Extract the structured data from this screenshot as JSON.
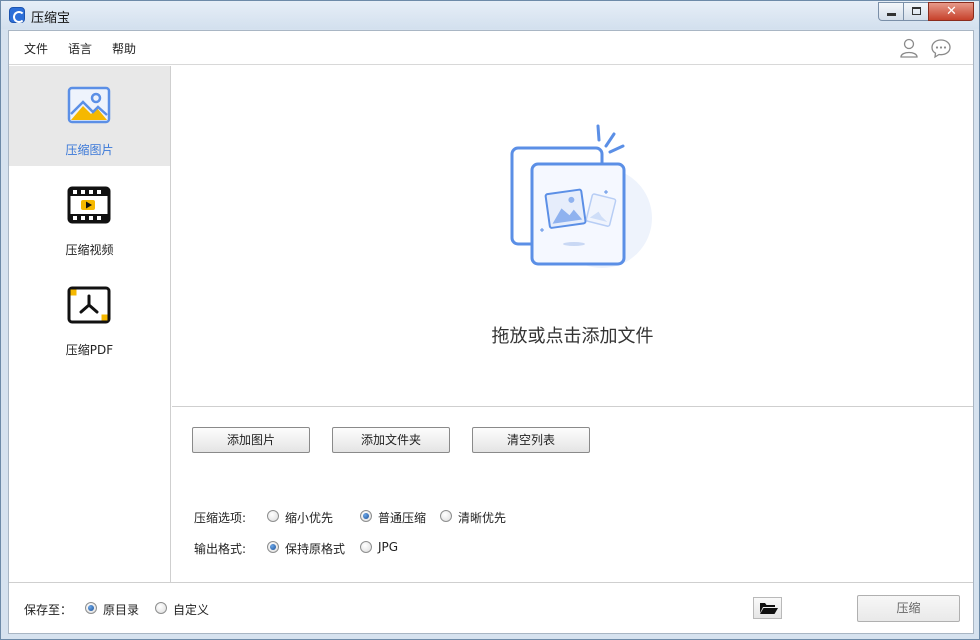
{
  "window": {
    "title": "压缩宝"
  },
  "menu": {
    "items": [
      "文件",
      "语言",
      "帮助"
    ],
    "user_icon": "user-icon",
    "chat_icon": "chat-bubble-icon"
  },
  "sidebar": {
    "items": [
      {
        "label": "压缩图片",
        "icon": "image-icon",
        "active": true
      },
      {
        "label": "压缩视频",
        "icon": "video-icon",
        "active": false
      },
      {
        "label": "压缩PDF",
        "icon": "pdf-icon",
        "active": false
      }
    ]
  },
  "dropzone": {
    "text": "拖放或点击添加文件",
    "icon": "add-images-illustration-icon"
  },
  "buttons": {
    "add_images": "添加图片",
    "add_folder": "添加文件夹",
    "clear_list": "清空列表"
  },
  "options": {
    "compress_label": "压缩选项:",
    "compress_choices": [
      {
        "label": "缩小优先",
        "selected": false
      },
      {
        "label": "普通压缩",
        "selected": true
      },
      {
        "label": "清晰优先",
        "selected": false
      }
    ],
    "format_label": "输出格式:",
    "format_choices": [
      {
        "label": "保持原格式",
        "selected": true
      },
      {
        "label": "JPG",
        "selected": false
      }
    ]
  },
  "footer": {
    "save_label": "保存至：",
    "save_choices": [
      {
        "label": "原目录",
        "selected": true
      },
      {
        "label": "自定义",
        "selected": false
      }
    ],
    "compress_button": "压缩",
    "folder_icon": "folder-open-icon"
  },
  "colors": {
    "accent": "#3a78d8",
    "icon_yellow": "#f5b800",
    "illus_blue": "#5b8fe6"
  }
}
